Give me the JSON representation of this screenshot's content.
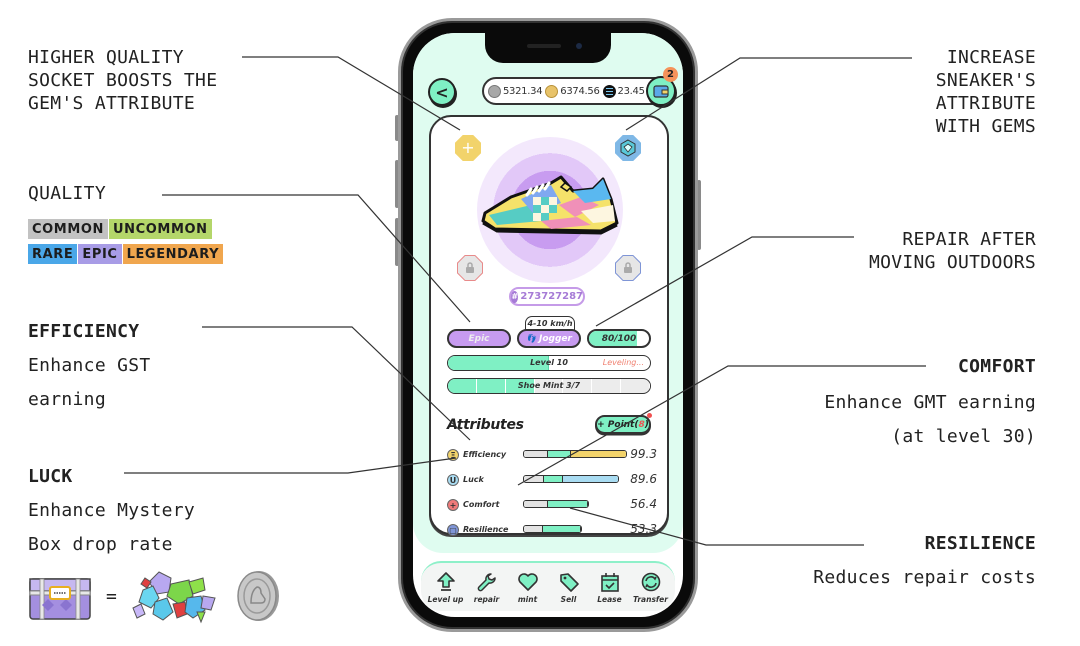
{
  "annotations": {
    "socket": {
      "lines": [
        "HIGHER QUALITY",
        "SOCKET BOOSTS THE",
        "GEM'S ATTRIBUTE"
      ]
    },
    "quality": {
      "title": "QUALITY",
      "tags": [
        {
          "label": "COMMON",
          "color": "#c2c2c2"
        },
        {
          "label": "UNCOMMON",
          "color": "#b4d66a"
        },
        {
          "label": "RARE",
          "color": "#4aa7e8"
        },
        {
          "label": "EPIC",
          "color": "#a89ce6"
        },
        {
          "label": "LEGENDARY",
          "color": "#f0a64e"
        }
      ]
    },
    "efficiency": {
      "title": "EFFICIENCY",
      "desc_lines": [
        "Enhance GST",
        "earning"
      ]
    },
    "luck": {
      "title": "LUCK",
      "desc_lines": [
        "Enhance Mystery",
        "Box drop rate"
      ],
      "equals": "="
    },
    "gems": {
      "lines": [
        "INCREASE",
        "SNEAKER'S",
        "ATTRIBUTE",
        "WITH GEMS"
      ]
    },
    "repair": {
      "lines": [
        "REPAIR AFTER",
        "MOVING OUTDOORS"
      ]
    },
    "comfort": {
      "title": "COMFORT",
      "desc_lines": [
        "Enhance GMT earning",
        "(at level 30)"
      ]
    },
    "resilience": {
      "title": "RESILIENCE",
      "desc_lines": [
        "Reduces repair costs"
      ]
    }
  },
  "app": {
    "back_icon": "chevron-left-icon",
    "wallet": {
      "balances": [
        {
          "icon": "gmt-coin-icon",
          "value": "5321.34",
          "color": "#a8a8a8"
        },
        {
          "icon": "gst-coin-icon",
          "value": "6374.56",
          "color": "#e8c36a"
        },
        {
          "icon": "sol-coin-icon",
          "value": "23.45",
          "color": "#111111"
        }
      ],
      "badge_count": "2"
    },
    "sneaker": {
      "id": "273727287",
      "hash_symbol": "#",
      "sockets": [
        {
          "position": "top-left",
          "state": "add",
          "color": "#f2d36b"
        },
        {
          "position": "top-right",
          "state": "gem",
          "color": "#7fb8e6"
        },
        {
          "position": "bottom-left",
          "state": "locked",
          "color": "#e88a8a"
        },
        {
          "position": "bottom-right",
          "state": "locked",
          "color": "#7f95d6"
        }
      ],
      "quality": "Epic",
      "type": "Jogger",
      "speed_range": "4-10 km/h",
      "durability": {
        "label": "80/100",
        "value": 80,
        "max": 100
      },
      "level": {
        "label": "Level 10",
        "status": "Leveling...",
        "progress": 0.5
      },
      "mint": {
        "label": "Shoe Mint 3/7",
        "count": 3,
        "max": 7
      }
    },
    "attributes": {
      "title": "Attributes",
      "point_button": {
        "prefix": "+ Point(",
        "count": "8",
        "suffix": ")"
      },
      "items": [
        {
          "name": "Efficiency",
          "icon_letter": "Ξ",
          "icon_color": "#f2d36b",
          "value": "99.3",
          "base": 0.24,
          "gem": 0.22,
          "bonus": 0.54,
          "bonus_color": "#f2d36b",
          "total": 1.0
        },
        {
          "name": "Luck",
          "icon_letter": "U",
          "icon_color": "#a9dcf2",
          "value": "89.6",
          "base": 0.21,
          "gem": 0.2,
          "bonus": 0.59,
          "bonus_color": "#a9dcf2",
          "total": 0.92
        },
        {
          "name": "Comfort",
          "icon_letter": "+",
          "icon_color": "#ef7a7a",
          "value": "56.4",
          "base": 0.37,
          "gem": 0.63,
          "bonus": 0,
          "bonus_color": "#7ff0c4",
          "total": 0.63
        },
        {
          "name": "Resilience",
          "icon_letter": "▢",
          "icon_color": "#7f95d6",
          "value": "53.3",
          "base": 0.34,
          "gem": 0.66,
          "bonus": 0,
          "bonus_color": "#7ff0c4",
          "total": 0.57
        }
      ]
    },
    "bottom_nav": [
      {
        "label": "Level up",
        "icon": "level-up-arrow-icon"
      },
      {
        "label": "repair",
        "icon": "wrench-icon"
      },
      {
        "label": "mint",
        "icon": "heart-icon"
      },
      {
        "label": "Sell",
        "icon": "price-tag-icon"
      },
      {
        "label": "Lease",
        "icon": "calendar-check-icon"
      },
      {
        "label": "Transfer",
        "icon": "transfer-cycle-icon"
      }
    ]
  }
}
